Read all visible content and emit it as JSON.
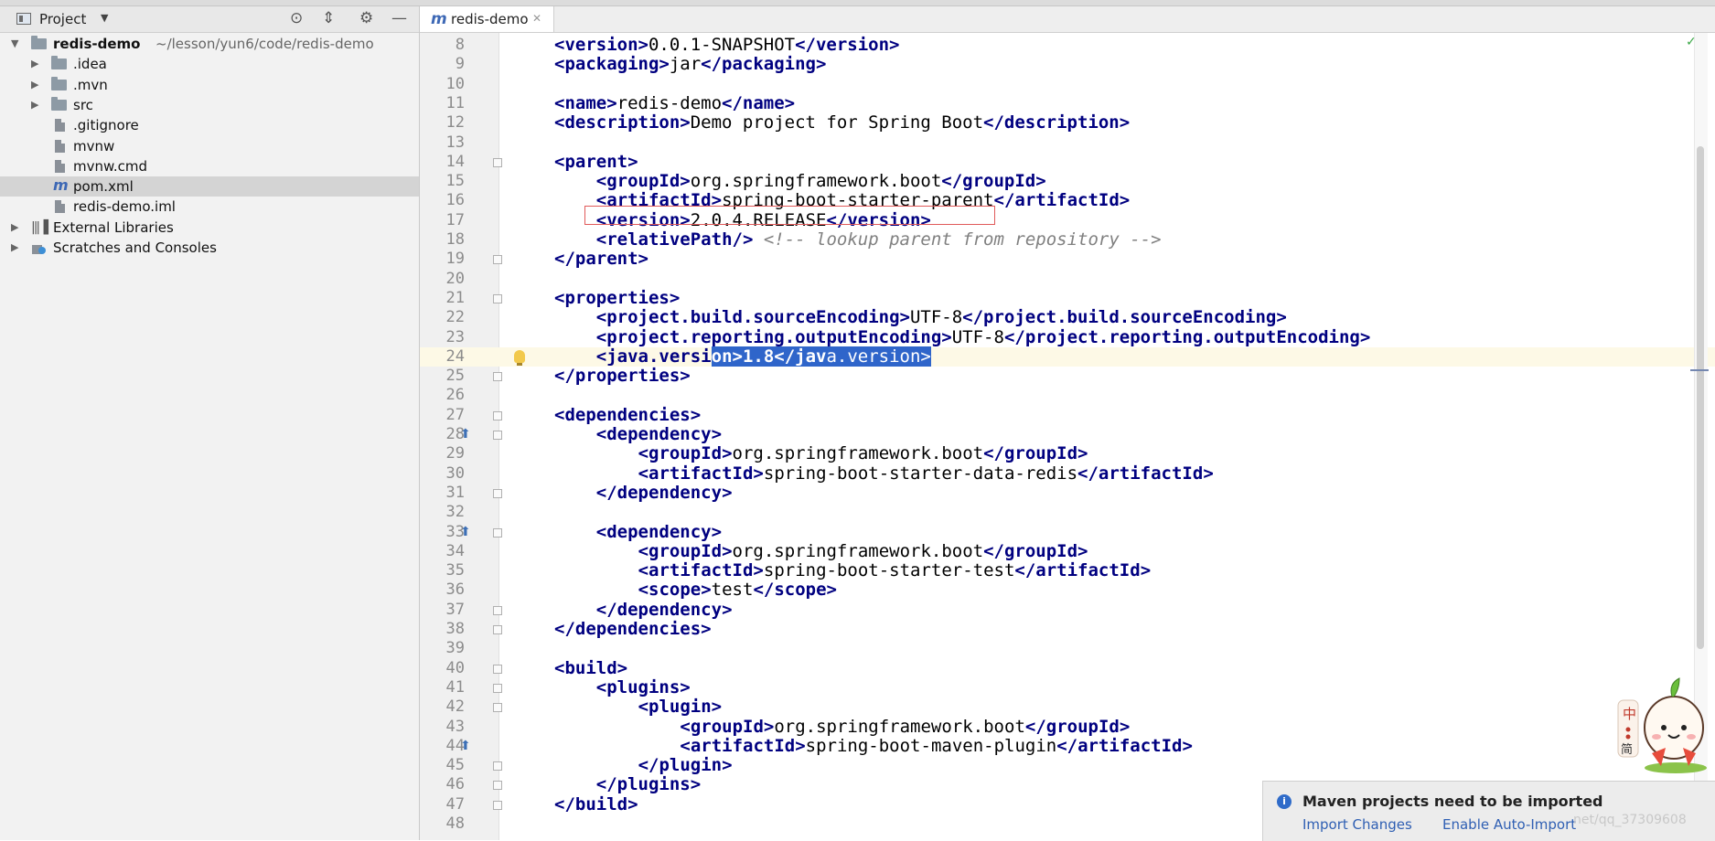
{
  "project_panel": {
    "title": "Project",
    "tree": [
      {
        "label": "redis-demo",
        "path": "~/lesson/yun6/code/redis-demo",
        "kind": "module",
        "icon": "folder-icon",
        "expanded": true
      },
      {
        "label": ".idea",
        "kind": "folder",
        "icon": "folder-icon"
      },
      {
        "label": ".mvn",
        "kind": "folder",
        "icon": "folder-icon"
      },
      {
        "label": "src",
        "kind": "folder",
        "icon": "folder-icon"
      },
      {
        "label": ".gitignore",
        "kind": "file",
        "icon": "file-icon"
      },
      {
        "label": "mvnw",
        "kind": "file",
        "icon": "file-icon"
      },
      {
        "label": "mvnw.cmd",
        "kind": "file",
        "icon": "file-icon"
      },
      {
        "label": "pom.xml",
        "kind": "maven-file",
        "icon": "maven-icon",
        "selected": true
      },
      {
        "label": "redis-demo.iml",
        "kind": "file",
        "icon": "file-icon"
      },
      {
        "label": "External Libraries",
        "kind": "libs",
        "icon": "library-icon"
      },
      {
        "label": "Scratches and Consoles",
        "kind": "scratches",
        "icon": "scratches-icon"
      }
    ]
  },
  "editor": {
    "tab_label": "redis-demo",
    "lines": [
      {
        "n": "8",
        "indent": 0,
        "parts": [
          [
            "t",
            "<version>"
          ],
          [
            "x",
            "0.0.1-SNAPSHOT"
          ],
          [
            "t",
            "</version>"
          ]
        ]
      },
      {
        "n": "9",
        "indent": 0,
        "parts": [
          [
            "t",
            "<packaging>"
          ],
          [
            "x",
            "jar"
          ],
          [
            "t",
            "</packaging>"
          ]
        ]
      },
      {
        "n": "10",
        "indent": 0,
        "parts": []
      },
      {
        "n": "11",
        "indent": 0,
        "parts": [
          [
            "t",
            "<name>"
          ],
          [
            "x",
            "redis-demo"
          ],
          [
            "t",
            "</name>"
          ]
        ]
      },
      {
        "n": "12",
        "indent": 0,
        "parts": [
          [
            "t",
            "<description>"
          ],
          [
            "x",
            "Demo project for Spring Boot"
          ],
          [
            "t",
            "</description>"
          ]
        ]
      },
      {
        "n": "13",
        "indent": 0,
        "parts": []
      },
      {
        "n": "14",
        "indent": 0,
        "parts": [
          [
            "t",
            "<parent>"
          ]
        ],
        "fold": true
      },
      {
        "n": "15",
        "indent": 1,
        "parts": [
          [
            "t",
            "<groupId>"
          ],
          [
            "x",
            "org.springframework.boot"
          ],
          [
            "t",
            "</groupId>"
          ]
        ]
      },
      {
        "n": "16",
        "indent": 1,
        "parts": [
          [
            "t",
            "<artifactId>"
          ],
          [
            "x",
            "spring-boot-starter-parent"
          ],
          [
            "t",
            "</artifactId>"
          ]
        ]
      },
      {
        "n": "17",
        "indent": 1,
        "parts": [
          [
            "t",
            "<version>"
          ],
          [
            "x",
            "2.0.4.RELEASE"
          ],
          [
            "t",
            "</version>"
          ]
        ]
      },
      {
        "n": "18",
        "indent": 1,
        "parts": [
          [
            "t",
            "<relativePath/>"
          ],
          [
            "x",
            " "
          ],
          [
            "c",
            "<!-- lookup parent from repository -->"
          ]
        ]
      },
      {
        "n": "19",
        "indent": 0,
        "parts": [
          [
            "t",
            "</parent>"
          ]
        ],
        "fold": true
      },
      {
        "n": "20",
        "indent": 0,
        "parts": []
      },
      {
        "n": "21",
        "indent": 0,
        "parts": [
          [
            "t",
            "<properties>"
          ]
        ],
        "fold": true
      },
      {
        "n": "22",
        "indent": 1,
        "parts": [
          [
            "t",
            "<project.build.sourceEncoding>"
          ],
          [
            "x",
            "UTF-8"
          ],
          [
            "t",
            "</project.build.sourceEncoding>"
          ]
        ]
      },
      {
        "n": "23",
        "indent": 1,
        "parts": [
          [
            "t",
            "<project.reporting.outputEncoding>"
          ],
          [
            "x",
            "UTF-8"
          ],
          [
            "t",
            "</project.reporting.outputEncoding>"
          ]
        ]
      },
      {
        "n": "24",
        "indent": 1,
        "current": true,
        "bulb": true,
        "parts": [
          [
            "selhl",
            "<java.versi"
          ],
          [
            "sel",
            "on>1.8</jav"
          ],
          [
            "selt",
            "a.version>"
          ]
        ]
      },
      {
        "n": "25",
        "indent": 0,
        "parts": [
          [
            "t",
            "</properties>"
          ]
        ],
        "fold": true
      },
      {
        "n": "26",
        "indent": 0,
        "parts": []
      },
      {
        "n": "27",
        "indent": 0,
        "parts": [
          [
            "t",
            "<dependencies>"
          ]
        ],
        "fold": true
      },
      {
        "n": "28",
        "indent": 1,
        "parts": [
          [
            "t",
            "<dependency>"
          ]
        ],
        "fold": true,
        "marker": true
      },
      {
        "n": "29",
        "indent": 2,
        "parts": [
          [
            "t",
            "<groupId>"
          ],
          [
            "x",
            "org.springframework.boot"
          ],
          [
            "t",
            "</groupId>"
          ]
        ]
      },
      {
        "n": "30",
        "indent": 2,
        "parts": [
          [
            "t",
            "<artifactId>"
          ],
          [
            "x",
            "spring-boot-starter-data-redis"
          ],
          [
            "t",
            "</artifactId>"
          ]
        ]
      },
      {
        "n": "31",
        "indent": 1,
        "parts": [
          [
            "t",
            "</dependency>"
          ]
        ],
        "fold": true
      },
      {
        "n": "32",
        "indent": 0,
        "parts": []
      },
      {
        "n": "33",
        "indent": 1,
        "parts": [
          [
            "t",
            "<dependency>"
          ]
        ],
        "fold": true,
        "marker": true
      },
      {
        "n": "34",
        "indent": 2,
        "parts": [
          [
            "t",
            "<groupId>"
          ],
          [
            "x",
            "org.springframework.boot"
          ],
          [
            "t",
            "</groupId>"
          ]
        ]
      },
      {
        "n": "35",
        "indent": 2,
        "parts": [
          [
            "t",
            "<artifactId>"
          ],
          [
            "x",
            "spring-boot-starter-test"
          ],
          [
            "t",
            "</artifactId>"
          ]
        ]
      },
      {
        "n": "36",
        "indent": 2,
        "parts": [
          [
            "t",
            "<scope>"
          ],
          [
            "x",
            "test"
          ],
          [
            "t",
            "</scope>"
          ]
        ]
      },
      {
        "n": "37",
        "indent": 1,
        "parts": [
          [
            "t",
            "</dependency>"
          ]
        ],
        "fold": true
      },
      {
        "n": "38",
        "indent": 0,
        "parts": [
          [
            "t",
            "</dependencies>"
          ]
        ],
        "fold": true
      },
      {
        "n": "39",
        "indent": 0,
        "parts": []
      },
      {
        "n": "40",
        "indent": 0,
        "parts": [
          [
            "t",
            "<build>"
          ]
        ],
        "fold": true
      },
      {
        "n": "41",
        "indent": 1,
        "parts": [
          [
            "t",
            "<plugins>"
          ]
        ],
        "fold": true
      },
      {
        "n": "42",
        "indent": 2,
        "parts": [
          [
            "t",
            "<plugin>"
          ]
        ],
        "fold": true
      },
      {
        "n": "43",
        "indent": 3,
        "parts": [
          [
            "t",
            "<groupId>"
          ],
          [
            "x",
            "org.springframework.boot"
          ],
          [
            "t",
            "</groupId>"
          ]
        ]
      },
      {
        "n": "44",
        "indent": 3,
        "parts": [
          [
            "t",
            "<artifactId>"
          ],
          [
            "x",
            "spring-boot-maven-plugin"
          ],
          [
            "t",
            "</artifactId>"
          ]
        ],
        "marker": true
      },
      {
        "n": "45",
        "indent": 2,
        "parts": [
          [
            "t",
            "</plugin>"
          ]
        ],
        "fold": true
      },
      {
        "n": "46",
        "indent": 1,
        "parts": [
          [
            "t",
            "</plugins>"
          ]
        ],
        "fold": true
      },
      {
        "n": "47",
        "indent": 0,
        "parts": [
          [
            "t",
            "</build>"
          ]
        ],
        "fold": true
      },
      {
        "n": "48",
        "indent": 0,
        "parts": []
      }
    ]
  },
  "notification": {
    "message": "Maven projects need to be imported",
    "import_changes": "Import Changes",
    "enable_auto_import": "Enable Auto-Import"
  },
  "watermark": "net/qq_37309608",
  "colors": {
    "xml_tag": "#000080",
    "selection": "#2f65ca",
    "current_line": "#fdf9e6",
    "link": "#2f5fb3"
  }
}
